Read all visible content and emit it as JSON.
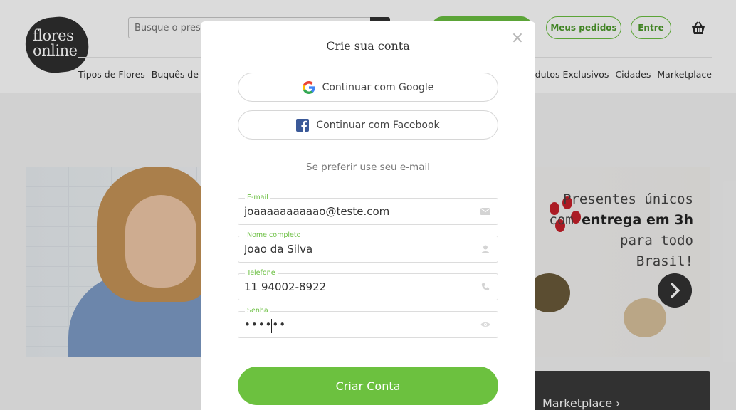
{
  "header": {
    "logo_text": "flores online",
    "search_placeholder": "Busque o presente",
    "my_orders_label": "Meus pedidos",
    "login_label": "Entre",
    "nav_left": [
      "Tipos de Flores",
      "Buquês de F"
    ],
    "nav_right": [
      "odutos Exclusivos",
      "Cidades",
      "Marketplace"
    ]
  },
  "hero": {
    "line1": "Presentes únicos",
    "line2_prefix": "com ",
    "line2_bold": "entrega em 3h",
    "line3": "para todo",
    "line4": "Brasil!"
  },
  "marketplace_bar": {
    "label": "Marketplace"
  },
  "modal": {
    "title": "Crie sua conta",
    "close_symbol": "×",
    "google_label": "Continuar com Google",
    "facebook_label": "Continuar com Facebook",
    "divider_text": "Se preferir use seu e-mail",
    "fields": {
      "email": {
        "label": "E-mail",
        "value": "joaaaaaaaaaao@teste.com"
      },
      "name": {
        "label": "Nome completo",
        "value": "Joao da Silva"
      },
      "phone": {
        "label": "Telefone",
        "value": "11 94002-8922"
      },
      "password": {
        "label": "Senha",
        "value": "••••••"
      }
    },
    "submit_label": "Criar Conta"
  },
  "colors": {
    "brand_green": "#6cc13f",
    "label_green": "#6abf40",
    "facebook_blue": "#3b5998",
    "dark": "#333333"
  }
}
